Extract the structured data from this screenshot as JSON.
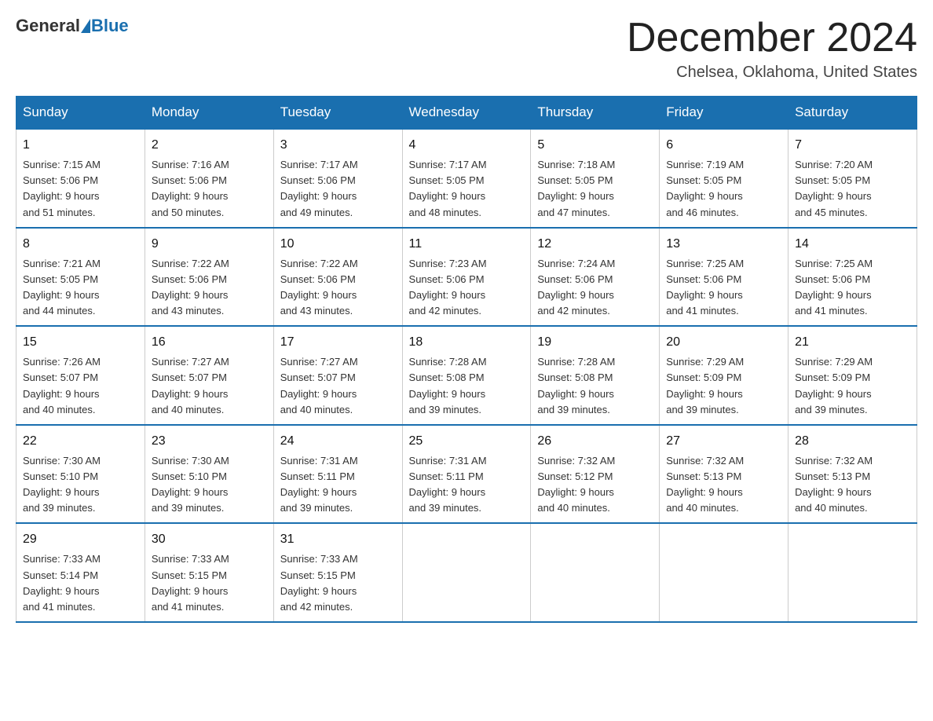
{
  "header": {
    "logo_general": "General",
    "logo_blue": "Blue",
    "month_title": "December 2024",
    "location": "Chelsea, Oklahoma, United States"
  },
  "days_of_week": [
    "Sunday",
    "Monday",
    "Tuesday",
    "Wednesday",
    "Thursday",
    "Friday",
    "Saturday"
  ],
  "weeks": [
    [
      {
        "day": "1",
        "sunrise": "7:15 AM",
        "sunset": "5:06 PM",
        "daylight": "9 hours and 51 minutes."
      },
      {
        "day": "2",
        "sunrise": "7:16 AM",
        "sunset": "5:06 PM",
        "daylight": "9 hours and 50 minutes."
      },
      {
        "day": "3",
        "sunrise": "7:17 AM",
        "sunset": "5:06 PM",
        "daylight": "9 hours and 49 minutes."
      },
      {
        "day": "4",
        "sunrise": "7:17 AM",
        "sunset": "5:05 PM",
        "daylight": "9 hours and 48 minutes."
      },
      {
        "day": "5",
        "sunrise": "7:18 AM",
        "sunset": "5:05 PM",
        "daylight": "9 hours and 47 minutes."
      },
      {
        "day": "6",
        "sunrise": "7:19 AM",
        "sunset": "5:05 PM",
        "daylight": "9 hours and 46 minutes."
      },
      {
        "day": "7",
        "sunrise": "7:20 AM",
        "sunset": "5:05 PM",
        "daylight": "9 hours and 45 minutes."
      }
    ],
    [
      {
        "day": "8",
        "sunrise": "7:21 AM",
        "sunset": "5:05 PM",
        "daylight": "9 hours and 44 minutes."
      },
      {
        "day": "9",
        "sunrise": "7:22 AM",
        "sunset": "5:06 PM",
        "daylight": "9 hours and 43 minutes."
      },
      {
        "day": "10",
        "sunrise": "7:22 AM",
        "sunset": "5:06 PM",
        "daylight": "9 hours and 43 minutes."
      },
      {
        "day": "11",
        "sunrise": "7:23 AM",
        "sunset": "5:06 PM",
        "daylight": "9 hours and 42 minutes."
      },
      {
        "day": "12",
        "sunrise": "7:24 AM",
        "sunset": "5:06 PM",
        "daylight": "9 hours and 42 minutes."
      },
      {
        "day": "13",
        "sunrise": "7:25 AM",
        "sunset": "5:06 PM",
        "daylight": "9 hours and 41 minutes."
      },
      {
        "day": "14",
        "sunrise": "7:25 AM",
        "sunset": "5:06 PM",
        "daylight": "9 hours and 41 minutes."
      }
    ],
    [
      {
        "day": "15",
        "sunrise": "7:26 AM",
        "sunset": "5:07 PM",
        "daylight": "9 hours and 40 minutes."
      },
      {
        "day": "16",
        "sunrise": "7:27 AM",
        "sunset": "5:07 PM",
        "daylight": "9 hours and 40 minutes."
      },
      {
        "day": "17",
        "sunrise": "7:27 AM",
        "sunset": "5:07 PM",
        "daylight": "9 hours and 40 minutes."
      },
      {
        "day": "18",
        "sunrise": "7:28 AM",
        "sunset": "5:08 PM",
        "daylight": "9 hours and 39 minutes."
      },
      {
        "day": "19",
        "sunrise": "7:28 AM",
        "sunset": "5:08 PM",
        "daylight": "9 hours and 39 minutes."
      },
      {
        "day": "20",
        "sunrise": "7:29 AM",
        "sunset": "5:09 PM",
        "daylight": "9 hours and 39 minutes."
      },
      {
        "day": "21",
        "sunrise": "7:29 AM",
        "sunset": "5:09 PM",
        "daylight": "9 hours and 39 minutes."
      }
    ],
    [
      {
        "day": "22",
        "sunrise": "7:30 AM",
        "sunset": "5:10 PM",
        "daylight": "9 hours and 39 minutes."
      },
      {
        "day": "23",
        "sunrise": "7:30 AM",
        "sunset": "5:10 PM",
        "daylight": "9 hours and 39 minutes."
      },
      {
        "day": "24",
        "sunrise": "7:31 AM",
        "sunset": "5:11 PM",
        "daylight": "9 hours and 39 minutes."
      },
      {
        "day": "25",
        "sunrise": "7:31 AM",
        "sunset": "5:11 PM",
        "daylight": "9 hours and 39 minutes."
      },
      {
        "day": "26",
        "sunrise": "7:32 AM",
        "sunset": "5:12 PM",
        "daylight": "9 hours and 40 minutes."
      },
      {
        "day": "27",
        "sunrise": "7:32 AM",
        "sunset": "5:13 PM",
        "daylight": "9 hours and 40 minutes."
      },
      {
        "day": "28",
        "sunrise": "7:32 AM",
        "sunset": "5:13 PM",
        "daylight": "9 hours and 40 minutes."
      }
    ],
    [
      {
        "day": "29",
        "sunrise": "7:33 AM",
        "sunset": "5:14 PM",
        "daylight": "9 hours and 41 minutes."
      },
      {
        "day": "30",
        "sunrise": "7:33 AM",
        "sunset": "5:15 PM",
        "daylight": "9 hours and 41 minutes."
      },
      {
        "day": "31",
        "sunrise": "7:33 AM",
        "sunset": "5:15 PM",
        "daylight": "9 hours and 42 minutes."
      },
      null,
      null,
      null,
      null
    ]
  ],
  "labels": {
    "sunrise": "Sunrise:",
    "sunset": "Sunset:",
    "daylight": "Daylight:"
  }
}
